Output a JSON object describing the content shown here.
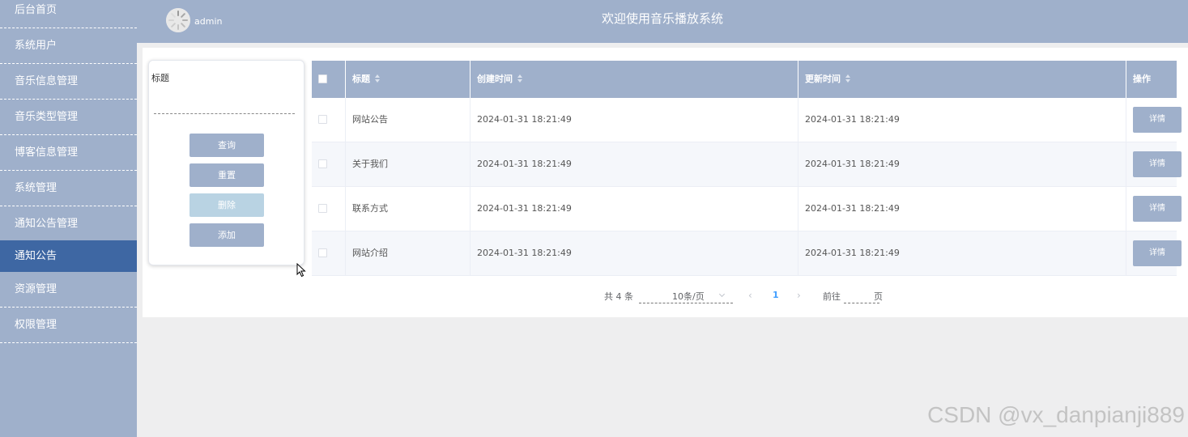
{
  "sidebar": {
    "items": [
      {
        "label": "后台首页",
        "active": false
      },
      {
        "label": "系统用户",
        "active": false
      },
      {
        "label": "音乐信息管理",
        "active": false
      },
      {
        "label": "音乐类型管理",
        "active": false
      },
      {
        "label": "博客信息管理",
        "active": false
      },
      {
        "label": "系统管理",
        "active": false
      },
      {
        "label": "通知公告管理",
        "active": false
      },
      {
        "label": "通知公告",
        "active": true
      },
      {
        "label": "资源管理",
        "active": false
      },
      {
        "label": "权限管理",
        "active": false
      }
    ]
  },
  "header": {
    "title": "欢迎使用音乐播放系统",
    "user": "admin",
    "avatar_icon": "avatar-placeholder-icon"
  },
  "search": {
    "label": "标题",
    "value": "",
    "placeholder": "",
    "query_label": "查询",
    "reset_label": "重置",
    "delete_label": "删除",
    "add_label": "添加"
  },
  "table": {
    "columns": [
      "标题",
      "创建时间",
      "更新时间",
      "操作"
    ],
    "rows": [
      {
        "title": "网站公告",
        "created": "2024-01-31 18:21:49",
        "updated": "2024-01-31 18:21:49",
        "action": "详情"
      },
      {
        "title": "关于我们",
        "created": "2024-01-31 18:21:49",
        "updated": "2024-01-31 18:21:49",
        "action": "详情"
      },
      {
        "title": "联系方式",
        "created": "2024-01-31 18:21:49",
        "updated": "2024-01-31 18:21:49",
        "action": "详情"
      },
      {
        "title": "网站介绍",
        "created": "2024-01-31 18:21:49",
        "updated": "2024-01-31 18:21:49",
        "action": "详情"
      }
    ]
  },
  "pagination": {
    "total": "共 4 条",
    "page_size": "10条/页",
    "current": "1",
    "goto_label": "前往",
    "page_suffix": "页",
    "goto_value": ""
  },
  "watermark": "CSDN @vx_danpianji889",
  "colors": {
    "sidebar": "#9fb0cb",
    "active": "#3e67a3",
    "button": "#9fb0cb",
    "disabled_button": "#b9d3e3"
  }
}
